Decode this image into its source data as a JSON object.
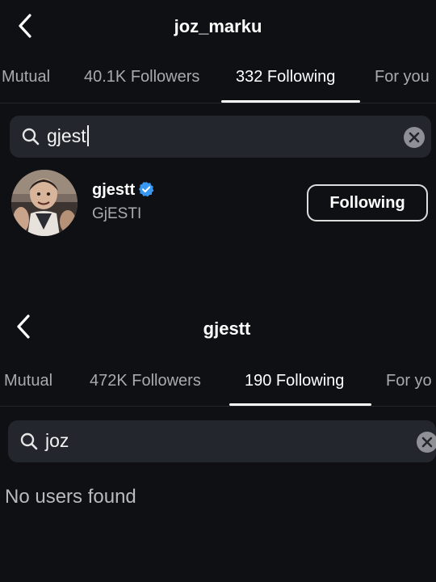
{
  "top": {
    "title": "joz_marku",
    "tabs": [
      {
        "label": "Mutual",
        "active": false
      },
      {
        "label": "40.1K Followers",
        "active": false
      },
      {
        "label": "332 Following",
        "active": true
      },
      {
        "label": "For you",
        "active": false
      }
    ],
    "search": {
      "value": "gjest"
    },
    "result": {
      "username": "gjestt",
      "verified": true,
      "full_name": "GjESTI",
      "button_label": "Following"
    }
  },
  "bottom": {
    "title": "gjestt",
    "tabs": [
      {
        "label": "Mutual",
        "active": false
      },
      {
        "label": "472K Followers",
        "active": false
      },
      {
        "label": "190 Following",
        "active": true
      },
      {
        "label": "For yo",
        "active": false
      }
    ],
    "search": {
      "value": "joz"
    },
    "empty_message": "No users found"
  },
  "icons": {
    "back": "chevron-left-icon",
    "search": "magnifier-icon",
    "clear": "x-circle-icon",
    "verified": "verified-badge-icon"
  },
  "colors": {
    "background": "#0e1014",
    "search_field": "#23262d",
    "muted_text": "#a8aab0",
    "verified_blue": "#3897f0"
  }
}
